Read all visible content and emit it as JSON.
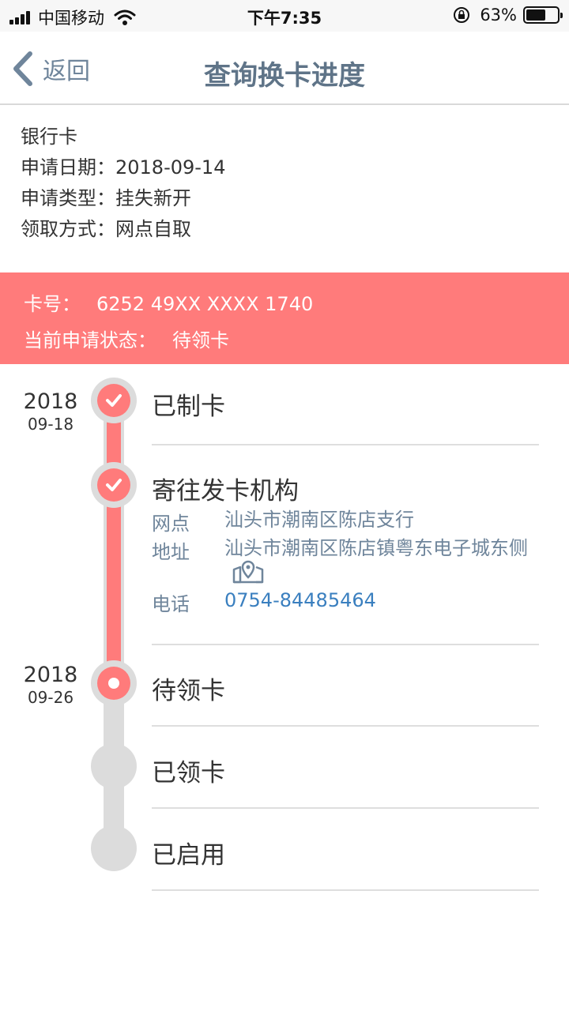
{
  "status_bar": {
    "carrier": "中国移动",
    "time": "下午7:35",
    "battery_percent_text": "63%",
    "battery_level": 0.63
  },
  "nav": {
    "back_label": "返回",
    "title": "查询换卡进度"
  },
  "info": {
    "card_type": "银行卡",
    "apply_date": "申请日期：2018-09-14",
    "apply_type": "申请类型：挂失新开",
    "pickup_method": "领取方式：网点自取"
  },
  "banner": {
    "card_no_label": "卡号：",
    "card_no": "6252 49XX XXXX 1740",
    "status_label": "当前申请状态：",
    "status_value": "待领卡",
    "color": "#ff7b7b"
  },
  "timeline": {
    "steps": [
      {
        "label": "已制卡",
        "year": "2018",
        "date": "09-18",
        "state": "done"
      },
      {
        "label": "寄往发卡机构",
        "state": "done"
      },
      {
        "label": "待领卡",
        "year": "2018",
        "date": "09-26",
        "state": "current"
      },
      {
        "label": "已领卡",
        "state": "pending"
      },
      {
        "label": "已启用",
        "state": "pending"
      }
    ],
    "branch": {
      "branch_key": "网点",
      "branch_value": "汕头市潮南区陈店支行",
      "address_key": "地址",
      "address_value": "汕头市潮南区陈店镇粤东电子城东侧",
      "phone_key": "电话",
      "phone_value": "0754-84485464"
    }
  },
  "colors": {
    "accent": "#ff7b7b",
    "rail": "#dcdcdc",
    "nav_text": "#5f7488",
    "link": "#3a7fbf"
  }
}
